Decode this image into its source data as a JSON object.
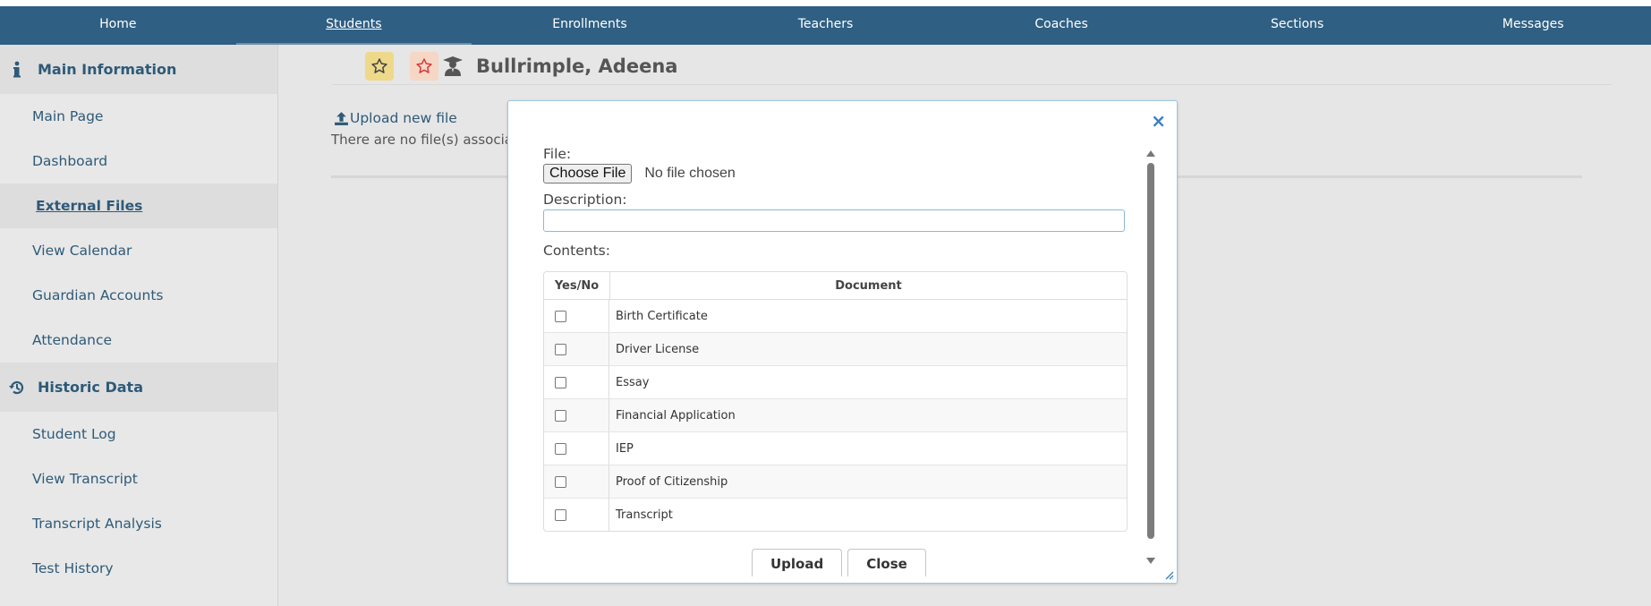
{
  "nav": {
    "items": [
      {
        "label": "Home",
        "active": false
      },
      {
        "label": "Students",
        "active": true
      },
      {
        "label": "Enrollments",
        "active": false
      },
      {
        "label": "Teachers",
        "active": false
      },
      {
        "label": "Coaches",
        "active": false
      },
      {
        "label": "Sections",
        "active": false
      },
      {
        "label": "Messages",
        "active": false
      }
    ]
  },
  "sidebar": {
    "main_header": {
      "label": "Main Information",
      "icon": "info-icon"
    },
    "main_items": [
      {
        "label": "Main Page"
      },
      {
        "label": "Dashboard"
      },
      {
        "label": "External Files",
        "active": true
      },
      {
        "label": "View Calendar"
      },
      {
        "label": "Guardian Accounts"
      },
      {
        "label": "Attendance"
      }
    ],
    "historic_header": {
      "label": "Historic Data",
      "icon": "history-icon"
    },
    "historic_items": [
      {
        "label": "Student Log"
      },
      {
        "label": "View Transcript"
      },
      {
        "label": "Transcript Analysis"
      },
      {
        "label": "Test History"
      }
    ]
  },
  "main": {
    "student_name": "Bullrimple, Adeena",
    "upload_link": "Upload new file",
    "no_files_text": "There are no file(s) associate"
  },
  "modal": {
    "close_symbol": "×",
    "file_label": "File:",
    "choose_file_label": "Choose File",
    "no_file_text": "No file chosen",
    "description_label": "Description:",
    "description_value": "",
    "contents_label": "Contents:",
    "table": {
      "headers": [
        "Yes/No",
        "Document"
      ],
      "rows": [
        {
          "document": "Birth Certificate",
          "checked": false
        },
        {
          "document": "Driver License",
          "checked": false
        },
        {
          "document": "Essay",
          "checked": false
        },
        {
          "document": "Financial Application",
          "checked": false
        },
        {
          "document": "IEP",
          "checked": false
        },
        {
          "document": "Proof of Citizenship",
          "checked": false
        },
        {
          "document": "Transcript",
          "checked": false
        }
      ]
    },
    "upload_button": "Upload",
    "close_button": "Close"
  },
  "colors": {
    "nav_bg": "#2f5f82",
    "link": "#2e5a78",
    "star_yellow_bg": "#eed98a",
    "star_pink_bg": "#f6d7c5"
  }
}
